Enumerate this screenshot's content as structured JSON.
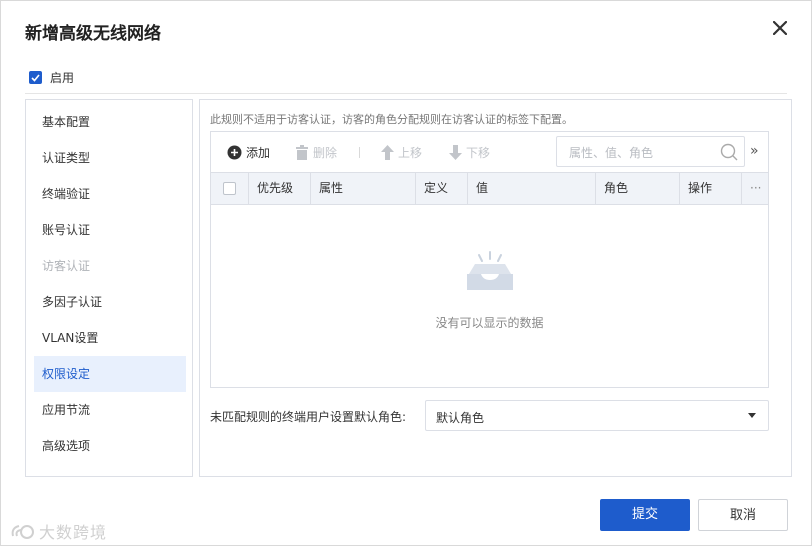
{
  "dialog": {
    "title": "新增高级无线网络",
    "close_icon": "close-icon"
  },
  "enable": {
    "label": "启用",
    "checked": true
  },
  "sidebar": {
    "items": [
      {
        "label": "基本配置",
        "state": "normal"
      },
      {
        "label": "认证类型",
        "state": "normal"
      },
      {
        "label": "终端验证",
        "state": "normal"
      },
      {
        "label": "账号认证",
        "state": "normal"
      },
      {
        "label": "访客认证",
        "state": "disabled"
      },
      {
        "label": "多因子认证",
        "state": "normal"
      },
      {
        "label": "VLAN设置",
        "state": "normal"
      },
      {
        "label": "权限设定",
        "state": "active"
      },
      {
        "label": "应用节流",
        "state": "normal"
      },
      {
        "label": "高级选项",
        "state": "normal"
      }
    ]
  },
  "main": {
    "note": "此规则不适用于访客认证，访客的角色分配规则在访客认证的标签下配置。",
    "toolbar": {
      "add": "添加",
      "delete": "删除",
      "move_up": "上移",
      "move_down": "下移",
      "search_placeholder": "属性、值、角色",
      "expand": "»"
    },
    "table": {
      "columns": [
        "优先级",
        "属性",
        "定义",
        "值",
        "角色",
        "操作",
        "···"
      ],
      "rows": [],
      "empty_text": "没有可以显示的数据"
    },
    "default_role": {
      "label": "未匹配规则的终端用户设置默认角色:",
      "value": "默认角色"
    }
  },
  "footer": {
    "submit": "提交",
    "cancel": "取消"
  },
  "watermark": {
    "text": "大数跨境"
  },
  "colors": {
    "accent": "#1e5ccc",
    "active_bg": "#e8f0fd",
    "header_bg": "#f0f3f8"
  }
}
